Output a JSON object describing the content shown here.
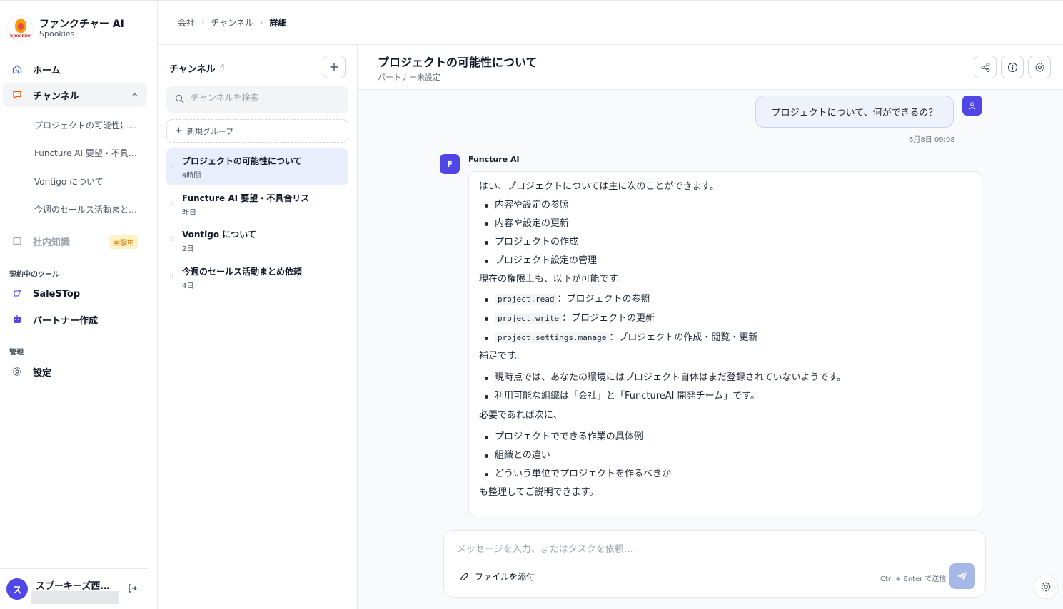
{
  "brand": {
    "name": "ファンクチャー AI",
    "sub": "Spookies",
    "logo_word": "Spookies"
  },
  "sidebar": {
    "home": "ホーム",
    "channels": "チャンネル",
    "channel_items": [
      "プロジェクトの可能性について",
      "Functure AI 要望・不具合リス",
      "Vontigo について",
      "今週のセールス活動まとめ依頼"
    ],
    "knowledge": "社内知識",
    "knowledge_badge": "実験中",
    "tools_label": "契約中のツール",
    "tools": [
      "SaleSTop",
      "パートナー作成"
    ],
    "admin_label": "管理",
    "settings": "設定"
  },
  "user": {
    "initial": "ス",
    "name": "スプーキーズ西…"
  },
  "breadcrumb": [
    "会社",
    "チャンネル",
    "詳細"
  ],
  "channel_panel": {
    "title": "チャンネル",
    "count": "4",
    "search_placeholder": "チャンネルを検索",
    "new_group": "新規グループ",
    "items": [
      {
        "name": "プロジェクトの可能性について",
        "time": "4時間"
      },
      {
        "name": "Functure AI 要望・不具合リス",
        "time": "昨日"
      },
      {
        "name": "Vontigo について",
        "time": "2日"
      },
      {
        "name": "今週のセールス活動まとめ依頼",
        "time": "4日"
      }
    ]
  },
  "chat": {
    "title": "プロジェクトの可能性について",
    "subtitle": "パートナー未設定",
    "user_message": "プロジェクトについて、何ができるの？",
    "user_time": "6月8日 09:08",
    "bot_initial": "F",
    "bot_name": "Functure AI",
    "bot": {
      "intro": "はい、プロジェクトについては主に次のことができます。",
      "list1": [
        "内容や設定の参照",
        "内容や設定の更新",
        "プロジェクトの作成",
        "プロジェクト設定の管理"
      ],
      "p2": "現在の権限上も、以下が可能です。",
      "perms": [
        {
          "code": "project.read",
          "desc": "：プロジェクトの参照"
        },
        {
          "code": "project.write",
          "desc": "：プロジェクトの更新"
        },
        {
          "code": "project.settings.manage",
          "desc": "：プロジェクトの作成・閲覧・更新"
        }
      ],
      "p3": "補足です。",
      "list3": [
        "現時点では、あなたの環境にはプロジェクト自体はまだ登録されていないようです。",
        "利用可能な組織は「会社」と「FunctureAI 開発チーム」です。"
      ],
      "p4": "必要であれば次に、",
      "list4": [
        "プロジェクトでできる作業の具体例",
        "組織との違い",
        "どういう単位でプロジェクトを作るべきか"
      ],
      "p5": "も整理してご説明できます。"
    },
    "composer": {
      "placeholder": "メッセージを入力、またはタスクを依頼…",
      "attach": "ファイルを添付",
      "hint": "Ctrl + Enter で送信"
    }
  },
  "colors": {
    "accent": "#4f46e5",
    "active_bg": "#e8eefc",
    "send": "#a5b8e8"
  }
}
